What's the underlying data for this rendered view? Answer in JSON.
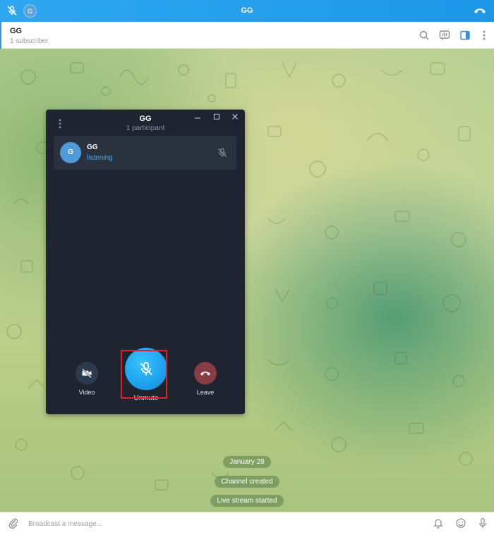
{
  "callbar": {
    "avatar_letter": "G",
    "title": "GG"
  },
  "chat": {
    "name": "GG",
    "subtitle": "1 subscriber"
  },
  "voice_chat": {
    "title": "GG",
    "participant_count": "1 participant",
    "participants": [
      {
        "avatar_letter": "G",
        "name": "GG",
        "status": "listening"
      }
    ],
    "controls": {
      "video_label": "Video",
      "unmute_label": "Unmute",
      "leave_label": "Leave"
    }
  },
  "service_messages": [
    "January 28",
    "Channel created",
    "Live stream started"
  ],
  "composer": {
    "placeholder": "Broadcast a message..."
  },
  "colors": {
    "accent": "#2ea6f0",
    "window_bg": "#1e2430",
    "unmute": "#1a9be8",
    "leave": "#8a3c44",
    "highlight": "#e0202a",
    "listening": "#4aa8f0"
  }
}
